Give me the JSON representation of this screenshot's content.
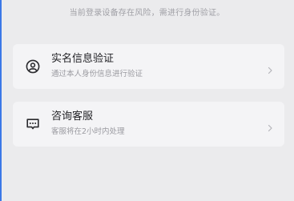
{
  "notice": "当前登录设备存在风险，需进行身份验证。",
  "options": [
    {
      "title": "实名信息验证",
      "subtitle": "通过本人身份信息进行验证",
      "icon": "user-circle-icon"
    },
    {
      "title": "咨询客服",
      "subtitle": "客服将在2小时内处理",
      "icon": "chat-bubble-icon"
    }
  ],
  "colors": {
    "background": "#ebebed",
    "card": "#f4f4f6",
    "accent_edge": "#3b78e7"
  }
}
